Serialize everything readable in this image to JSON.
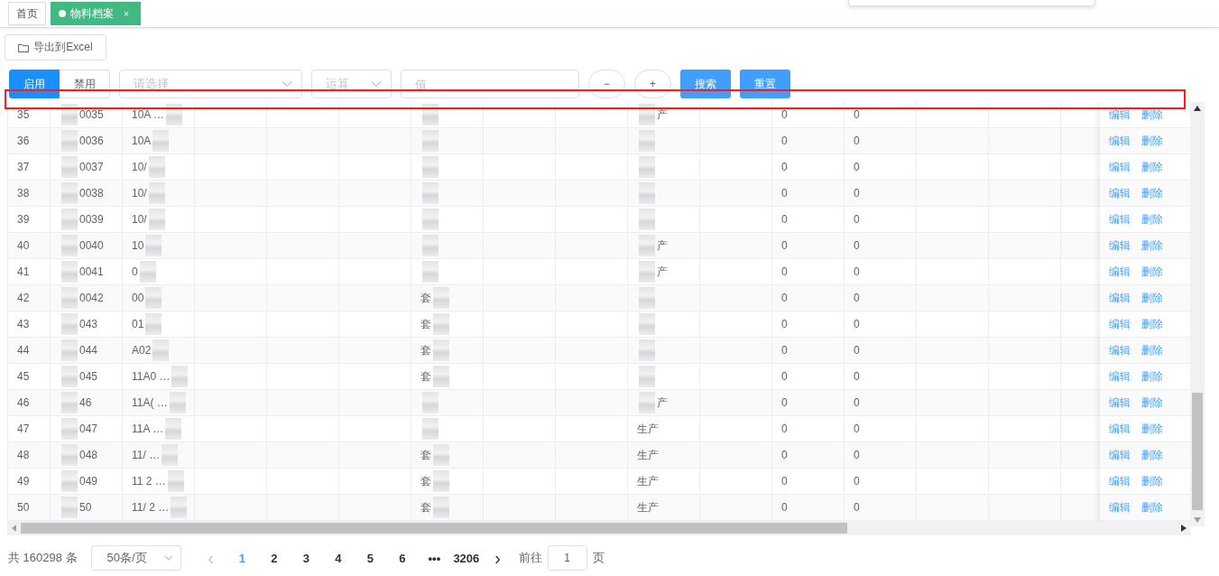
{
  "tabs": [
    {
      "label": "首页",
      "selected": false
    },
    {
      "label": "物料档案",
      "selected": true,
      "close": "×"
    }
  ],
  "export_button": "导出到Excel",
  "status_toggle": [
    {
      "label": "启用",
      "selected": true
    },
    {
      "label": "禁用",
      "selected": false
    }
  ],
  "filters": {
    "field_placeholder": "请选择",
    "operator_placeholder": "运算",
    "value_placeholder": "值",
    "remove_button": "−",
    "add_button": "+",
    "search_button": "搜索",
    "reset_button": "重置"
  },
  "highlight_frame": {
    "shown": true
  },
  "table": {
    "rows": [
      {
        "index": "35",
        "code": "0035",
        "name": "10A …",
        "unit": "",
        "type": "产",
        "col_a": "0",
        "col_b": "0",
        "redacted": true,
        "actions": [
          "编辑",
          "删除"
        ]
      },
      {
        "index": "36",
        "code": "0036",
        "name": "10A",
        "unit": "",
        "type": "",
        "col_a": "0",
        "col_b": "0",
        "redacted": true,
        "actions": [
          "编辑",
          "删除"
        ]
      },
      {
        "index": "37",
        "code": "0037",
        "name": "10/",
        "unit": "",
        "type": "",
        "col_a": "0",
        "col_b": "0",
        "redacted": true,
        "actions": [
          "编辑",
          "删除"
        ]
      },
      {
        "index": "38",
        "code": "0038",
        "name": "10/",
        "unit": "",
        "type": "",
        "col_a": "0",
        "col_b": "0",
        "redacted": true,
        "actions": [
          "编辑",
          "删除"
        ]
      },
      {
        "index": "39",
        "code": "0039",
        "name": "10/",
        "unit": "",
        "type": "",
        "col_a": "0",
        "col_b": "0",
        "redacted": true,
        "actions": [
          "编辑",
          "删除"
        ]
      },
      {
        "index": "40",
        "code": "0040",
        "name": "10",
        "unit": "",
        "type": "产",
        "col_a": "0",
        "col_b": "0",
        "redacted": true,
        "actions": [
          "编辑",
          "删除"
        ]
      },
      {
        "index": "41",
        "code": "0041",
        "name": "0",
        "unit": "",
        "type": "产",
        "col_a": "0",
        "col_b": "0",
        "redacted": true,
        "actions": [
          "编辑",
          "删除"
        ]
      },
      {
        "index": "42",
        "code": "0042",
        "name": "00",
        "unit": "套",
        "type": "",
        "col_a": "0",
        "col_b": "0",
        "redacted": true,
        "actions": [
          "编辑",
          "删除"
        ]
      },
      {
        "index": "43",
        "code": "043",
        "name": "01",
        "unit": "套",
        "type": "",
        "col_a": "0",
        "col_b": "0",
        "redacted": true,
        "actions": [
          "编辑",
          "删除"
        ]
      },
      {
        "index": "44",
        "code": "044",
        "name": "A02",
        "unit": "套",
        "type": "",
        "col_a": "0",
        "col_b": "0",
        "redacted": true,
        "actions": [
          "编辑",
          "删除"
        ]
      },
      {
        "index": "45",
        "code": "045",
        "name": "11A0 …",
        "unit": "套",
        "type": "",
        "col_a": "0",
        "col_b": "0",
        "redacted": true,
        "actions": [
          "编辑",
          "删除"
        ]
      },
      {
        "index": "46",
        "code": "46",
        "name": "11A( …",
        "unit": "",
        "type": "产",
        "col_a": "0",
        "col_b": "0",
        "redacted": true,
        "actions": [
          "编辑",
          "删除"
        ]
      },
      {
        "index": "47",
        "code": "047",
        "name": "11A …",
        "unit": "",
        "type": "生产",
        "col_a": "0",
        "col_b": "0",
        "redacted": true,
        "actions": [
          "编辑",
          "删除"
        ]
      },
      {
        "index": "48",
        "code": "048",
        "name": "11/ …",
        "unit": "套",
        "type": "生产",
        "col_a": "0",
        "col_b": "0",
        "redacted": true,
        "actions": [
          "编辑",
          "删除"
        ]
      },
      {
        "index": "49",
        "code": "049",
        "name": "11 2 …",
        "unit": "套",
        "type": "生产",
        "col_a": "0",
        "col_b": "0",
        "redacted": true,
        "actions": [
          "编辑",
          "删除"
        ]
      },
      {
        "index": "50",
        "code": "50",
        "name": "11/ 2 …",
        "unit": "套",
        "type": "生产",
        "col_a": "0",
        "col_b": "0",
        "redacted": true,
        "actions": [
          "编辑",
          "删除"
        ]
      }
    ]
  },
  "pagination": {
    "total": "共 160298 条",
    "page_size": "50条/页",
    "prev": "‹",
    "next": "›",
    "pages": [
      {
        "label": "1",
        "selected": true
      },
      {
        "label": "2",
        "selected": false
      },
      {
        "label": "3",
        "selected": false
      },
      {
        "label": "4",
        "selected": false
      },
      {
        "label": "5",
        "selected": false
      },
      {
        "label": "6",
        "selected": false
      },
      {
        "label": "•••",
        "selected": false
      },
      {
        "label": "3206",
        "selected": false
      }
    ],
    "goto_label": "前往",
    "goto_value": "1",
    "goto_suffix": "页"
  }
}
